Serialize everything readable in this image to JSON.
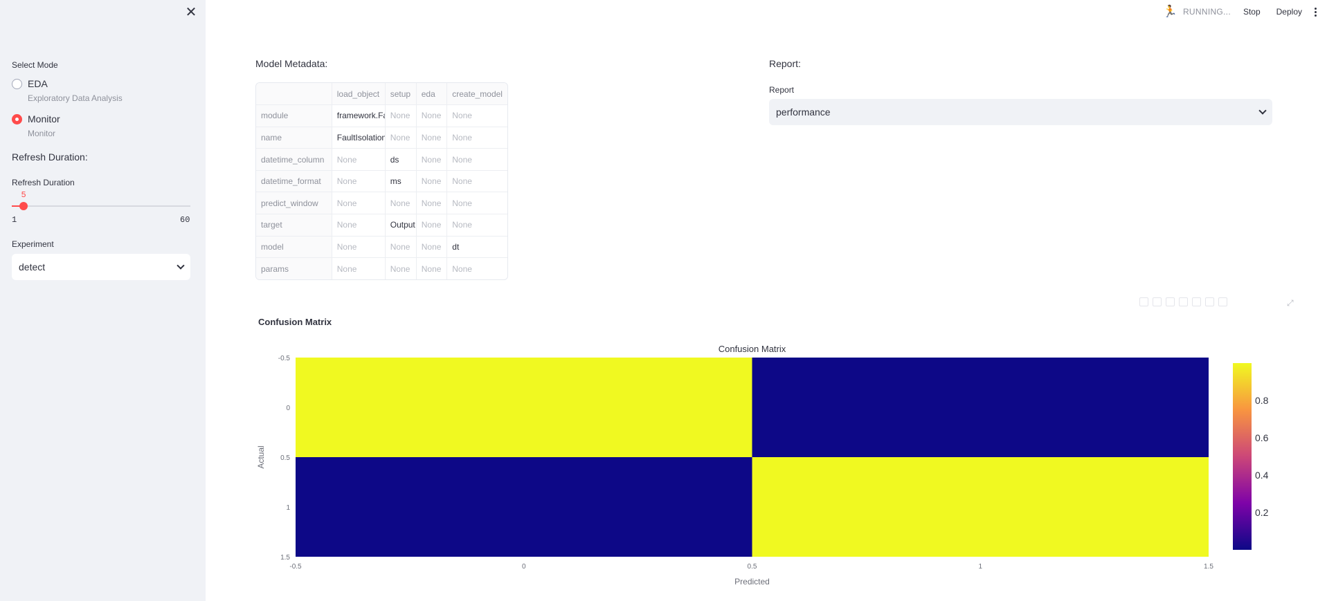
{
  "sidebar": {
    "close_icon": "close-icon",
    "select_mode_label": "Select Mode",
    "modes": [
      {
        "label": "EDA",
        "caption": "Exploratory Data Analysis",
        "selected": false
      },
      {
        "label": "Monitor",
        "caption": "Monitor",
        "selected": true
      }
    ],
    "refresh_heading": "Refresh Duration:",
    "refresh_label": "Refresh Duration",
    "slider": {
      "value": 5,
      "min": 1,
      "max": 60,
      "value_text": "5",
      "min_text": "1",
      "max_text": "60"
    },
    "experiment_label": "Experiment",
    "experiment_value": "detect"
  },
  "topbar": {
    "status_icon": "running-man-icon",
    "status_text": "RUNNING...",
    "stop_label": "Stop",
    "deploy_label": "Deploy",
    "menu_icon": "kebab-menu-icon"
  },
  "main": {
    "model_metadata_label": "Model Metadata:",
    "report_heading": "Report:",
    "report_label": "Report",
    "report_value": "performance",
    "metadata_table": {
      "columns": [
        "",
        "load_object",
        "setup",
        "eda",
        "create_model"
      ],
      "rows": [
        [
          "module",
          "framework.Fa",
          "None",
          "None",
          "None"
        ],
        [
          "name",
          "FaultIsolation",
          "None",
          "None",
          "None"
        ],
        [
          "datetime_column",
          "None",
          "ds",
          "None",
          "None"
        ],
        [
          "datetime_format",
          "None",
          "ms",
          "None",
          "None"
        ],
        [
          "predict_window",
          "None",
          "None",
          "None",
          "None"
        ],
        [
          "target",
          "None",
          "Output",
          "None",
          "None"
        ],
        [
          "model",
          "None",
          "None",
          "None",
          "dt"
        ],
        [
          "params",
          "None",
          "None",
          "None",
          "None"
        ]
      ]
    },
    "confusion_heading": "Confusion Matrix"
  },
  "colors": {
    "accent": "#ff4b4b",
    "heat_high": "#f0f921",
    "heat_low": "#0d0887"
  },
  "chart_data": {
    "type": "heatmap",
    "title": "Confusion Matrix",
    "xlabel": "Predicted",
    "ylabel": "Actual",
    "x": [
      0,
      1
    ],
    "y": [
      0,
      1
    ],
    "z": [
      [
        1,
        0
      ],
      [
        0,
        1
      ]
    ],
    "xlim": [
      -0.5,
      1.5
    ],
    "ylim": [
      -0.5,
      1.5
    ],
    "x_ticks": [
      "-0.5",
      "0",
      "0.5",
      "1",
      "1.5"
    ],
    "y_ticks": [
      "-0.5",
      "0",
      "0.5",
      "1",
      "1.5"
    ],
    "colorscale": "plasma",
    "colorbar_ticks": [
      "0.2",
      "0.4",
      "0.6",
      "0.8"
    ],
    "colorbar_range": [
      0,
      1
    ]
  }
}
